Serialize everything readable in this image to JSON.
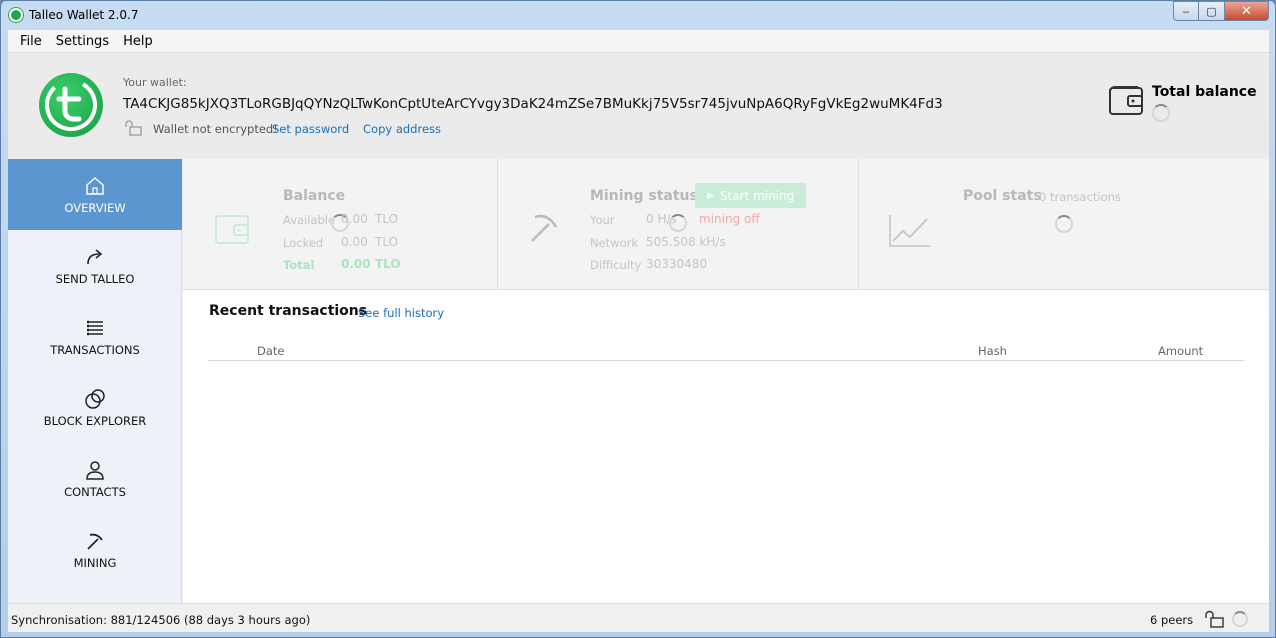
{
  "window": {
    "title": "Talleo Wallet 2.0.7",
    "min": "‒",
    "max": "▢",
    "close": "✕"
  },
  "menu": {
    "file": "File",
    "settings": "Settings",
    "help": "Help"
  },
  "header": {
    "wallet_label": "Your wallet:",
    "wallet_address": "TA4CKJG85kJXQ3TLoRGBJqQYNzQLTwKonCptUteArCYvgy3DaK24mZSe7BMuKkj75V5sr745jvuNpA6QRyFgVkEg2wuMK4Fd3",
    "not_encrypted": "Wallet not encrypted!",
    "set_password": "Set password",
    "copy_address": "Copy address",
    "total_balance_label": "Total balance"
  },
  "sidebar": {
    "items": [
      {
        "label": "OVERVIEW",
        "icon": "home-icon",
        "active": true
      },
      {
        "label": "SEND TALLEO",
        "icon": "send-icon"
      },
      {
        "label": "TRANSACTIONS",
        "icon": "list-icon"
      },
      {
        "label": "BLOCK EXPLORER",
        "icon": "explorer-icon"
      },
      {
        "label": "CONTACTS",
        "icon": "contacts-icon"
      },
      {
        "label": "MINING",
        "icon": "pickaxe-icon"
      }
    ]
  },
  "balance": {
    "title": "Balance",
    "available_label": "Available",
    "available_value": "0.00",
    "available_unit": "TLO",
    "locked_label": "Locked",
    "locked_value": "0.00",
    "locked_unit": "TLO",
    "total_label": "Total",
    "total_value": "0.00",
    "total_unit": "TLO"
  },
  "mining": {
    "title": "Mining status",
    "start_button": "Start mining",
    "your_label": "Your",
    "your_value": "0 H/s",
    "your_status": "mining off",
    "network_label": "Network",
    "network_value": "505.508 kH/s",
    "difficulty_label": "Difficulty",
    "difficulty_value": "30330480"
  },
  "pool": {
    "title": "Pool stats",
    "transactions": "0 transactions"
  },
  "recent": {
    "title": "Recent transactions",
    "see_history": "See full history",
    "columns": {
      "date": "Date",
      "hash": "Hash",
      "amount": "Amount"
    }
  },
  "status": {
    "sync": "Synchronisation: 881/124506 (88 days 3 hours ago)",
    "peers": "6 peers"
  },
  "colors": {
    "accent": "#5b96d0",
    "brand": "#1fa84b",
    "link": "#1a6ebd"
  }
}
